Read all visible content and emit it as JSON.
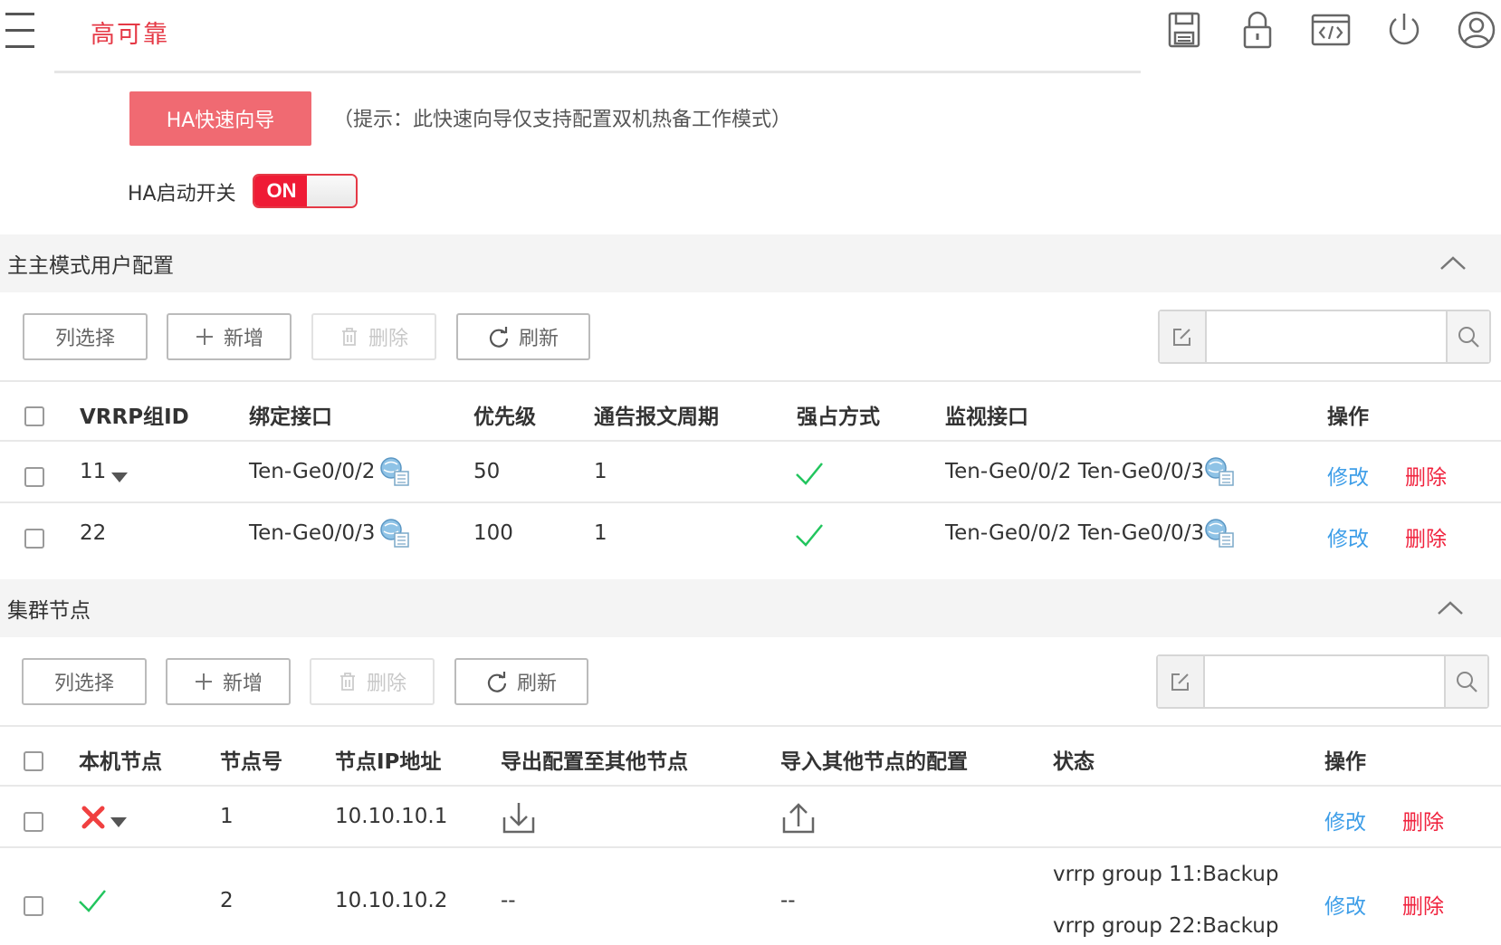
{
  "header": {
    "title": "高可靠",
    "icons": [
      "save-icon",
      "lock-icon",
      "code-icon",
      "power-icon",
      "user-icon"
    ]
  },
  "wizard": {
    "button_label": "HA快速向导",
    "hint": "（提示：此快速向导仅支持配置双机热备工作模式）"
  },
  "ha_switch": {
    "label": "HA启动开关",
    "state": "ON"
  },
  "colors": {
    "accent": "#e53946",
    "link_blue": "#3e9ee8",
    "delete_red": "#f0233e",
    "ok_green": "#22c55e",
    "error_red": "#f04040"
  },
  "toolbar": {
    "column_select": "列选择",
    "add": "新增",
    "delete": "删除",
    "refresh": "刷新",
    "search_placeholder": ""
  },
  "vrrp_section": {
    "title": "主主模式用户配置",
    "columns": [
      "VRRP组ID",
      "绑定接口",
      "优先级",
      "通告报文周期",
      "强占方式",
      "监视接口",
      "操作"
    ],
    "rows": [
      {
        "group_id": "11",
        "bind_iface": "Ten-Ge0/0/2",
        "priority": "50",
        "period": "1",
        "preempt": true,
        "monitor": "Ten-Ge0/0/2 Ten-Ge0/0/3",
        "edit": "修改",
        "delete": "删除"
      },
      {
        "group_id": "22",
        "bind_iface": "Ten-Ge0/0/3",
        "priority": "100",
        "period": "1",
        "preempt": true,
        "monitor": "Ten-Ge0/0/2 Ten-Ge0/0/3",
        "edit": "修改",
        "delete": "删除"
      }
    ]
  },
  "cluster_section": {
    "title": "集群节点",
    "columns": [
      "本机节点",
      "节点号",
      "节点IP地址",
      "导出配置至其他节点",
      "导入其他节点的配置",
      "状态",
      "操作"
    ],
    "rows": [
      {
        "local": false,
        "node": "1",
        "ip": "10.10.10.1",
        "export": "",
        "import": "",
        "status": [
          "",
          ""
        ],
        "edit": "修改",
        "delete": "删除"
      },
      {
        "local": true,
        "node": "2",
        "ip": "10.10.10.2",
        "export": "--",
        "import": "--",
        "status": [
          "vrrp group 11:Backup",
          "vrrp group 22:Backup"
        ],
        "edit": "修改",
        "delete": "删除"
      }
    ]
  }
}
